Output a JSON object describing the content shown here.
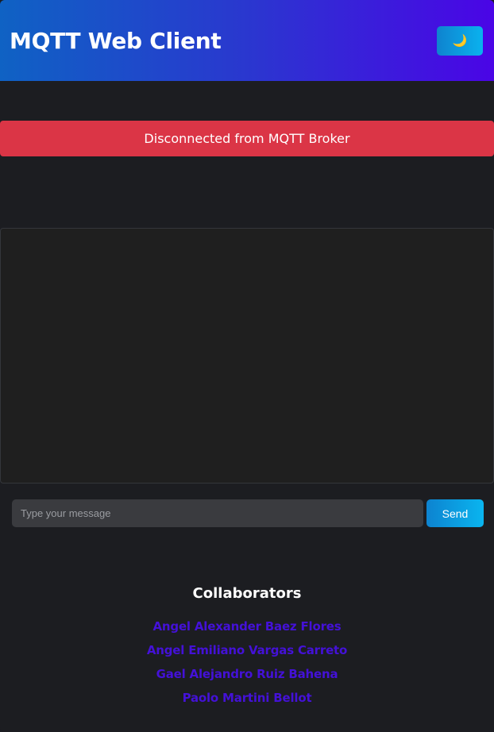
{
  "header": {
    "title": "MQTT Web Client",
    "theme_toggle_icon": "moon-icon",
    "theme_toggle_glyph": "🌙"
  },
  "status": {
    "text": "Disconnected from MQTT Broker",
    "color": "#db3546"
  },
  "composer": {
    "placeholder": "Type your message",
    "value": "",
    "send_label": "Send"
  },
  "collaborators": {
    "title": "Collaborators",
    "names": [
      "Angel Alexander Baez Flores",
      "Angel Emiliano Vargas Carreto",
      "Gael Alejandro Ruiz Bahena",
      "Paolo Martini Bellot"
    ]
  },
  "colors": {
    "background": "#1c1d21",
    "header_gradient_start": "#0f62c4",
    "header_gradient_end": "#4a05e6",
    "accent": "#0ab2ee",
    "link": "#4411d8"
  }
}
